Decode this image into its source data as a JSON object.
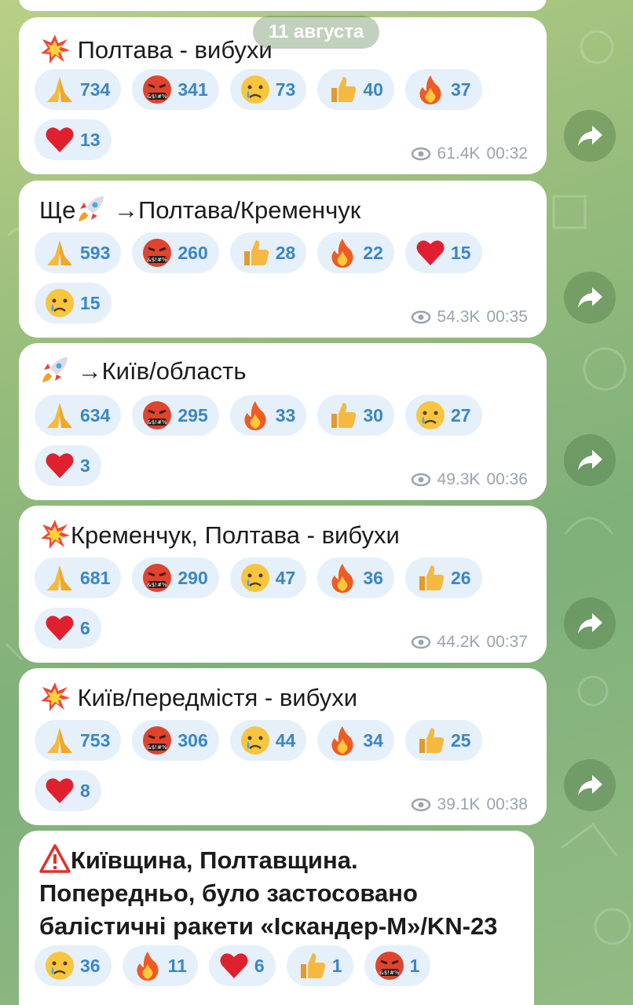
{
  "date_chip": "11 августа",
  "messages": [
    {
      "icon": "explosion-icon",
      "text": "Полтава - вибухи",
      "reactions": [
        {
          "icon": "pray",
          "count": "734"
        },
        {
          "icon": "angry",
          "count": "341"
        },
        {
          "icon": "cry",
          "count": "73"
        },
        {
          "icon": "thumbs",
          "count": "40"
        },
        {
          "icon": "fire",
          "count": "37"
        },
        {
          "icon": "heart",
          "count": "13"
        }
      ],
      "views": "61.4K",
      "time": "00:32"
    },
    {
      "prefix": "Ще",
      "icon": "rocket-icon",
      "text": "→Полтава/Кременчук",
      "reactions": [
        {
          "icon": "pray",
          "count": "593"
        },
        {
          "icon": "angry",
          "count": "260"
        },
        {
          "icon": "thumbs",
          "count": "28"
        },
        {
          "icon": "fire",
          "count": "22"
        },
        {
          "icon": "heart",
          "count": "15"
        },
        {
          "icon": "cry",
          "count": "15"
        }
      ],
      "views": "54.3K",
      "time": "00:35"
    },
    {
      "icon": "rocket-icon",
      "text": "→Київ/область",
      "reactions": [
        {
          "icon": "pray",
          "count": "634"
        },
        {
          "icon": "angry",
          "count": "295"
        },
        {
          "icon": "fire",
          "count": "33"
        },
        {
          "icon": "thumbs",
          "count": "30"
        },
        {
          "icon": "cry",
          "count": "27"
        },
        {
          "icon": "heart",
          "count": "3"
        }
      ],
      "views": "49.3K",
      "time": "00:36"
    },
    {
      "icon": "explosion-icon",
      "text": "Кременчук, Полтава - вибухи",
      "reactions": [
        {
          "icon": "pray",
          "count": "681"
        },
        {
          "icon": "angry",
          "count": "290"
        },
        {
          "icon": "cry",
          "count": "47"
        },
        {
          "icon": "fire",
          "count": "36"
        },
        {
          "icon": "thumbs",
          "count": "26"
        },
        {
          "icon": "heart",
          "count": "6"
        }
      ],
      "views": "44.2K",
      "time": "00:37"
    },
    {
      "icon": "explosion-icon",
      "text": "Київ/передмістя - вибухи",
      "reactions": [
        {
          "icon": "pray",
          "count": "753"
        },
        {
          "icon": "angry",
          "count": "306"
        },
        {
          "icon": "cry",
          "count": "44"
        },
        {
          "icon": "fire",
          "count": "34"
        },
        {
          "icon": "thumbs",
          "count": "25"
        },
        {
          "icon": "heart",
          "count": "8"
        }
      ],
      "views": "39.1K",
      "time": "00:38"
    },
    {
      "icon": "warning-icon",
      "text_lines": [
        "Київщина, Полтавщина.",
        "Попередньо, було застосовано",
        "балістичні ракети «Іскандер-М»/KN-23"
      ],
      "reactions": [
        {
          "icon": "cry",
          "count": "36"
        },
        {
          "icon": "fire",
          "count": "11"
        },
        {
          "icon": "heart",
          "count": "6"
        },
        {
          "icon": "thumbs",
          "count": "1"
        },
        {
          "icon": "angry",
          "count": "1"
        }
      ]
    }
  ]
}
